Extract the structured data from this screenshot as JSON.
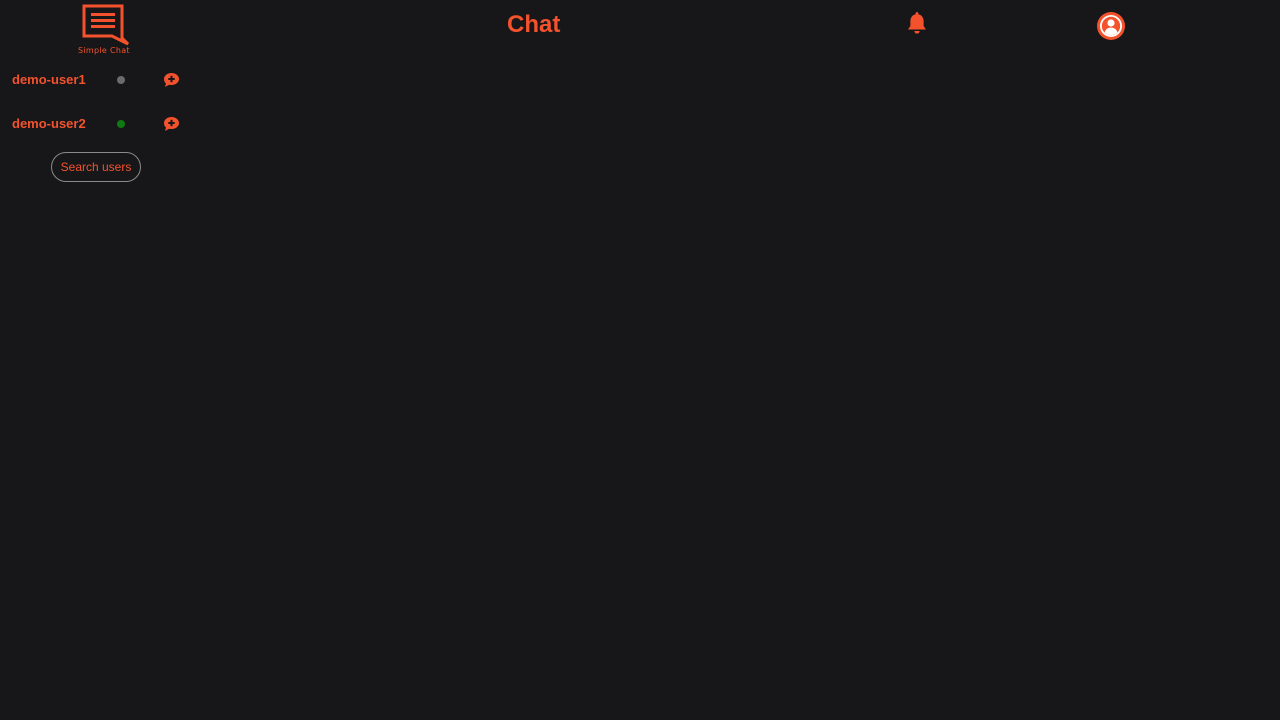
{
  "header": {
    "logo_text": "Simple Chat",
    "title": "Chat",
    "notification_icon": "bell-icon",
    "profile_icon": "user-circle-icon"
  },
  "sidebar": {
    "users": [
      {
        "name": "demo-user1",
        "status": "offline",
        "status_color": "#6b6b6b",
        "action_icon": "chat-plus-icon"
      },
      {
        "name": "demo-user2",
        "status": "online",
        "status_color": "#0f7a0f",
        "action_icon": "chat-plus-icon"
      }
    ],
    "search_button_label": "Search users"
  },
  "colors": {
    "accent": "#f4522d",
    "background": "#171719",
    "button_border": "#8a8a8a"
  }
}
